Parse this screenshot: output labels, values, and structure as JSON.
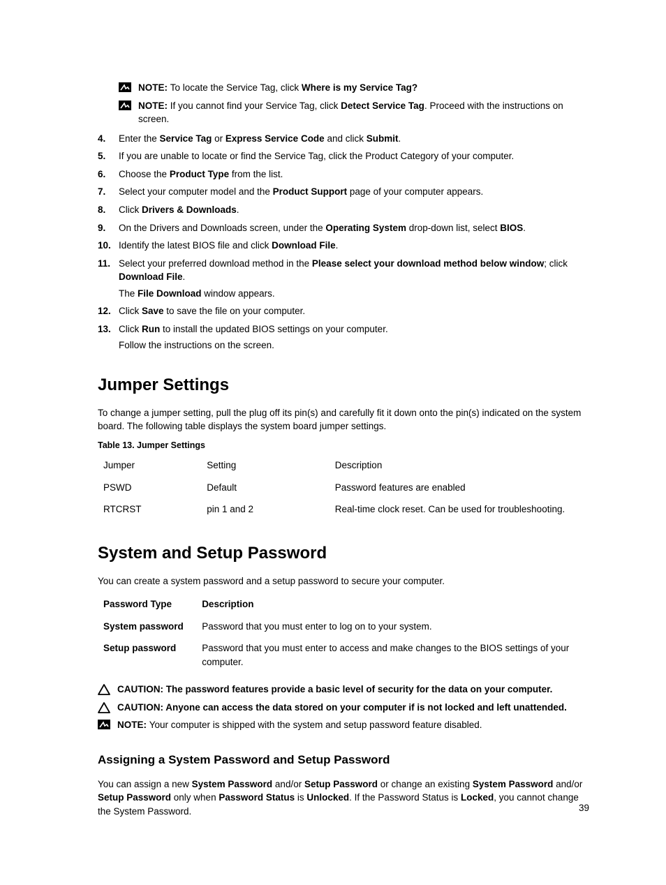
{
  "notes": {
    "n1_prefix": "NOTE: ",
    "n1_t1": "To locate the Service Tag, click ",
    "n1_b1": "Where is my Service Tag?",
    "n2_prefix": "NOTE: ",
    "n2_t1": "If you cannot find your Service Tag, click ",
    "n2_b1": "Detect Service Tag",
    "n2_t2": ". Proceed with the instructions on screen."
  },
  "steps": {
    "s4_t1": "Enter the ",
    "s4_b1": "Service Tag",
    "s4_t2": " or ",
    "s4_b2": "Express Service Code",
    "s4_t3": " and click ",
    "s4_b3": "Submit",
    "s4_t4": ".",
    "s5_t1": "If you are unable to locate or find the Service Tag, click the Product Category of your computer.",
    "s6_t1": "Choose the ",
    "s6_b1": "Product Type",
    "s6_t2": " from the list.",
    "s7_t1": "Select your computer model and the ",
    "s7_b1": "Product Support",
    "s7_t2": " page of your computer appears.",
    "s8_t1": "Click ",
    "s8_b1": "Drivers & Downloads",
    "s8_t2": ".",
    "s9_t1": "On the Drivers and Downloads screen, under the ",
    "s9_b1": "Operating System",
    "s9_t2": " drop-down list, select ",
    "s9_b2": "BIOS",
    "s9_t3": ".",
    "s10_t1": "Identify the latest BIOS file and click ",
    "s10_b1": "Download File",
    "s10_t2": ".",
    "s11_t1": "Select your preferred download method in the ",
    "s11_b1": "Please select your download method below window",
    "s11_t2": "; click ",
    "s11_b2": "Download File",
    "s11_t3": ".",
    "s11_sub_t1": "The ",
    "s11_sub_b1": "File Download",
    "s11_sub_t2": " window appears.",
    "s12_t1": "Click ",
    "s12_b1": "Save",
    "s12_t2": " to save the file on your computer.",
    "s13_t1": "Click ",
    "s13_b1": "Run",
    "s13_t2": " to install the updated BIOS settings on your computer.",
    "s13_sub": "Follow the instructions on the screen."
  },
  "jumper": {
    "heading": "Jumper Settings",
    "intro": "To change a jumper setting, pull the plug off its pin(s) and carefully fit it down onto the pin(s) indicated on the system board. The following table displays the system board jumper settings.",
    "caption": "Table 13. Jumper Settings",
    "headers": {
      "c1": "Jumper",
      "c2": "Setting",
      "c3": "Description"
    },
    "rows": [
      {
        "c1": "PSWD",
        "c2": "Default",
        "c3": "Password features are enabled"
      },
      {
        "c1": "RTCRST",
        "c2": "pin 1 and 2",
        "c3": "Real-time clock reset. Can be used for troubleshooting."
      }
    ]
  },
  "pw": {
    "heading": "System and Setup Password",
    "intro": "You can create a system password and a setup password to secure your computer.",
    "headers": {
      "term": "Password Type",
      "desc": "Description"
    },
    "rows": [
      {
        "term": "System password",
        "desc": "Password that you must enter to log on to your system."
      },
      {
        "term": "Setup password",
        "desc": "Password that you must enter to access and make changes to the BIOS settings of your computer."
      }
    ],
    "caution1": "CAUTION: The password features provide a basic level of security for the data on your computer.",
    "caution2": "CAUTION: Anyone can access the data stored on your computer if is not locked and left unattended.",
    "note_prefix": "NOTE: ",
    "note_text": "Your computer is shipped with the system and setup password feature disabled.",
    "sub_heading": "Assigning a System Password and Setup Password",
    "assign_t1": "You can assign a new ",
    "assign_b1": "System Password",
    "assign_t2": " and/or ",
    "assign_b2": "Setup Password",
    "assign_t3": " or change an existing ",
    "assign_b3": "System Password",
    "assign_t4": " and/or ",
    "assign_b4": "Setup Password",
    "assign_t5": " only when ",
    "assign_b5": "Password Status",
    "assign_t6": " is ",
    "assign_b6": "Unlocked",
    "assign_t7": ". If the Password Status is ",
    "assign_b7": "Locked",
    "assign_t8": ", you cannot change the System Password."
  },
  "page_number": "39"
}
